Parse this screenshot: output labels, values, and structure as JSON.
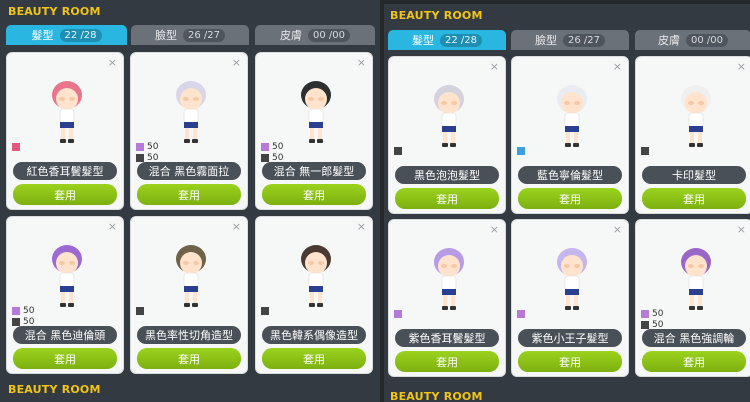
{
  "left": {
    "title": "BEAUTY ROOM",
    "bottom_title": "BEAUTY ROOM",
    "tabs": [
      {
        "label": "髮型",
        "count": "22 /28"
      },
      {
        "label": "臉型",
        "count": "26 /27"
      },
      {
        "label": "皮膚",
        "count": "00 /00"
      }
    ],
    "cards": [
      {
        "name": "紅色香耳鬢髮型",
        "apply": "套用",
        "close": "×",
        "hair": "#e8758c",
        "swatches": [
          {
            "color": "#e2577b",
            "value": ""
          }
        ]
      },
      {
        "name": "混合 黑色霧面拉",
        "apply": "套用",
        "close": "×",
        "hair": "#d9d6ea",
        "swatches": [
          {
            "color": "#b77ad8",
            "value": "50"
          },
          {
            "color": "#444444",
            "value": "50"
          }
        ]
      },
      {
        "name": "混合 無一郎髮型",
        "apply": "套用",
        "close": "×",
        "hair": "#2c3030",
        "swatches": [
          {
            "color": "#b77ad8",
            "value": "50"
          },
          {
            "color": "#444444",
            "value": "50"
          }
        ]
      },
      {
        "name": "混合 黑色迪倫頭",
        "apply": "套用",
        "close": "×",
        "hair": "#9b6bd3",
        "swatches": [
          {
            "color": "#b77ad8",
            "value": "50"
          },
          {
            "color": "#444444",
            "value": "50"
          }
        ]
      },
      {
        "name": "黑色率性切角造型",
        "apply": "套用",
        "close": "×",
        "hair": "#6e6248",
        "swatches": [
          {
            "color": "#444444",
            "value": ""
          }
        ]
      },
      {
        "name": "黑色韓系偶像造型",
        "apply": "套用",
        "close": "×",
        "hair": "#4a3a33",
        "swatches": [
          {
            "color": "#444444",
            "value": ""
          }
        ]
      }
    ]
  },
  "right": {
    "title": "BEAUTY ROOM",
    "bottom_title": "BEAUTY ROOM",
    "tabs": [
      {
        "label": "髮型",
        "count": "22 /28"
      },
      {
        "label": "臉型",
        "count": "26 /27"
      },
      {
        "label": "皮膚",
        "count": "00 /00"
      }
    ],
    "cards": [
      {
        "name": "黑色泡泡髮型",
        "apply": "套用",
        "close": "×",
        "hair": "#d4d2dd",
        "swatches": [
          {
            "color": "#444444",
            "value": ""
          }
        ]
      },
      {
        "name": "藍色寧倫髮型",
        "apply": "套用",
        "close": "×",
        "hair": "#e9edf1",
        "swatches": [
          {
            "color": "#3b9fe0",
            "value": ""
          }
        ]
      },
      {
        "name": "卡印髮型",
        "apply": "套用",
        "close": "×",
        "hair": "#f0f0f0",
        "swatches": [
          {
            "color": "#444444",
            "value": ""
          }
        ]
      },
      {
        "name": "紫色香耳鬢髮型",
        "apply": "套用",
        "close": "×",
        "hair": "#b79be6",
        "swatches": [
          {
            "color": "#b77ad8",
            "value": ""
          }
        ]
      },
      {
        "name": "紫色小王子髮型",
        "apply": "套用",
        "close": "×",
        "hair": "#c6b6ee",
        "swatches": [
          {
            "color": "#b77ad8",
            "value": ""
          }
        ]
      },
      {
        "name": "混合 黑色強調輪",
        "apply": "套用",
        "close": "×",
        "hair": "#9a67c8",
        "swatches": [
          {
            "color": "#b77ad8",
            "value": "50"
          },
          {
            "color": "#444444",
            "value": "50"
          }
        ]
      }
    ]
  }
}
